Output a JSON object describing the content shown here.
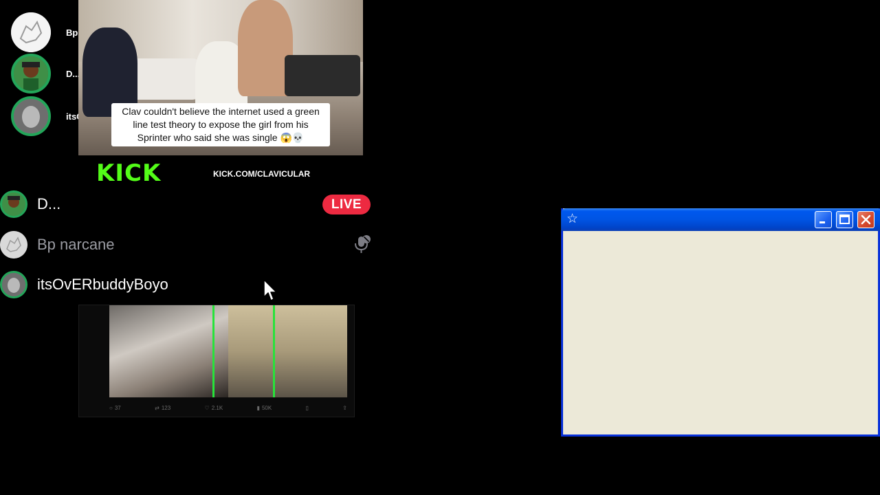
{
  "overlay": {
    "speakers": [
      {
        "name": "Bp narcane",
        "ring": false
      },
      {
        "name": "D...",
        "ring": true
      },
      {
        "name": "itsOvERbuddyBoyo",
        "ring": true
      }
    ]
  },
  "stream": {
    "caption": "Clav couldn't believe the internet used a green line test theory to expose the girl from his Sprinter who said she was single 😱💀",
    "logo": "KICK",
    "url": "KICK.COM/CLAVICULAR"
  },
  "voice": {
    "members": [
      {
        "name": "D...",
        "dim": false,
        "ring": true
      },
      {
        "name": "Bp narcane",
        "dim": true,
        "ring": false
      },
      {
        "name": "itsOvERbuddyBoyo",
        "dim": false,
        "ring": true
      }
    ],
    "live_badge": "LIVE"
  },
  "post": {
    "actions": {
      "replies": "37",
      "reposts": "123",
      "likes": "2.1K",
      "views": "50K"
    }
  },
  "window": {
    "title": ""
  },
  "colors": {
    "speaking_ring": "#23a559",
    "live_badge": "#ed2a41",
    "kick_green": "#53fc18",
    "xp_titlebar": "#0054e3",
    "xp_client": "#ece9d8"
  }
}
